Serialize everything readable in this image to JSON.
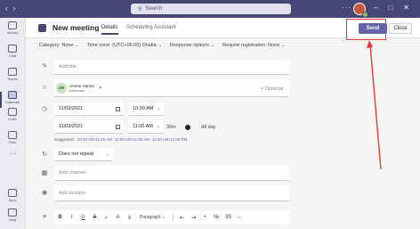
{
  "topbar": {
    "search_placeholder": "Search",
    "more": "···"
  },
  "rail": {
    "items": [
      {
        "label": "Activity"
      },
      {
        "label": "Chat"
      },
      {
        "label": "Teams"
      },
      {
        "label": "Calendar"
      },
      {
        "label": "Calls"
      },
      {
        "label": "Files"
      },
      {
        "label": "Apps"
      },
      {
        "label": "Help"
      }
    ],
    "more": "···"
  },
  "header": {
    "title": "New meeting",
    "tabs": [
      {
        "label": "Details"
      },
      {
        "label": "Scheduling Assistant"
      }
    ],
    "send_label": "Send",
    "close_label": "Close"
  },
  "options": {
    "category": "Category: None",
    "timezone": "Time zone: (UTC+06:00) Dhaka",
    "response": "Response options",
    "registration": "Require registration: None"
  },
  "form": {
    "title_placeholder": "Add title",
    "attendee": {
      "initials": "UH",
      "name": "Umme Hanna",
      "status": "Unknown"
    },
    "optional_label": "+ Optional",
    "start_date": "11/03/2021",
    "start_time": "10:30 AM",
    "end_date": "11/03/2021",
    "end_time": "11:00 AM",
    "duration": "30m",
    "allday_label": "All day",
    "suggested_label": "Suggested:",
    "suggested_slots": [
      "10:30 AM-11:00 AM",
      "11:00 AM-11:30 AM",
      "11:30 AM-12:00 PM"
    ],
    "repeat": "Does not repeat",
    "channel_placeholder": "Add channel",
    "location_placeholder": "Add location",
    "toolbar": {
      "bold": "B",
      "italic": "I",
      "underline": "U",
      "strike": "S",
      "paragraph": "Paragraph",
      "quote": "99"
    }
  },
  "colors": {
    "brand": "#464775",
    "send": "#6264a7",
    "highlight": "#e53935"
  }
}
